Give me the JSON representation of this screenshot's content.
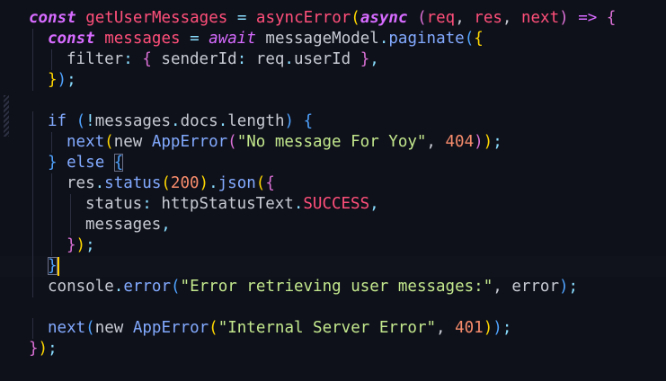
{
  "editor": {
    "language": "javascript",
    "theme_colors": {
      "background": "#0f111a",
      "keyword": "#d66bff",
      "function": "#ff4f7a",
      "identifier": "#c7c9d3",
      "string": "#c3e88d",
      "number": "#f78c6c",
      "punctuation": "#89ddff",
      "bracket_yellow": "#ffd700",
      "bracket_magenta": "#da70d6",
      "bracket_blue": "#4fa3ff",
      "cursor": "#ffcc00"
    },
    "lines": [
      {
        "indent": 0,
        "tokens": [
          {
            "t": "const",
            "c": "#d66bff",
            "italic": true,
            "bold": true
          },
          {
            "t": " ",
            "c": "#c7c9d3"
          },
          {
            "t": "getUserMessages",
            "c": "#ff4f7a"
          },
          {
            "t": " ",
            "c": "#c7c9d3"
          },
          {
            "t": "=",
            "c": "#89ddff"
          },
          {
            "t": " ",
            "c": "#c7c9d3"
          },
          {
            "t": "asyncError",
            "c": "#ff4f7a"
          },
          {
            "t": "(",
            "c": "#ffd700"
          },
          {
            "t": "async",
            "c": "#d66bff",
            "italic": true,
            "bold": true
          },
          {
            "t": " ",
            "c": "#c7c9d3"
          },
          {
            "t": "(",
            "c": "#da70d6"
          },
          {
            "t": "req",
            "c": "#ff4f7a"
          },
          {
            "t": ", ",
            "c": "#c7c9d3"
          },
          {
            "t": "res",
            "c": "#ff4f7a"
          },
          {
            "t": ", ",
            "c": "#c7c9d3"
          },
          {
            "t": "next",
            "c": "#ff4f7a"
          },
          {
            "t": ")",
            "c": "#da70d6"
          },
          {
            "t": " ",
            "c": "#c7c9d3"
          },
          {
            "t": "=>",
            "c": "#d66bff"
          },
          {
            "t": " ",
            "c": "#c7c9d3"
          },
          {
            "t": "{",
            "c": "#da70d6"
          }
        ]
      },
      {
        "indent": 1,
        "tokens": [
          {
            "t": "const",
            "c": "#d66bff",
            "italic": true,
            "bold": true
          },
          {
            "t": " ",
            "c": "#c7c9d3"
          },
          {
            "t": "messages",
            "c": "#ff4f7a"
          },
          {
            "t": " ",
            "c": "#c7c9d3"
          },
          {
            "t": "=",
            "c": "#89ddff"
          },
          {
            "t": " ",
            "c": "#c7c9d3"
          },
          {
            "t": "await",
            "c": "#d66bff",
            "italic": true
          },
          {
            "t": " ",
            "c": "#c7c9d3"
          },
          {
            "t": "messageModel",
            "c": "#c7c9d3"
          },
          {
            "t": ".",
            "c": "#89ddff"
          },
          {
            "t": "paginate",
            "c": "#82aaff"
          },
          {
            "t": "(",
            "c": "#4fa3ff"
          },
          {
            "t": "{",
            "c": "#ffd700"
          }
        ]
      },
      {
        "indent": 2,
        "tokens": [
          {
            "t": "filter",
            "c": "#c7c9d3"
          },
          {
            "t": ":",
            "c": "#89ddff"
          },
          {
            "t": " ",
            "c": "#c7c9d3"
          },
          {
            "t": "{",
            "c": "#da70d6"
          },
          {
            "t": " ",
            "c": "#c7c9d3"
          },
          {
            "t": "senderId",
            "c": "#c7c9d3"
          },
          {
            "t": ":",
            "c": "#89ddff"
          },
          {
            "t": " ",
            "c": "#c7c9d3"
          },
          {
            "t": "req",
            "c": "#c7c9d3"
          },
          {
            "t": ".",
            "c": "#89ddff"
          },
          {
            "t": "userId",
            "c": "#c7c9d3"
          },
          {
            "t": " ",
            "c": "#c7c9d3"
          },
          {
            "t": "}",
            "c": "#da70d6"
          },
          {
            "t": ",",
            "c": "#89ddff"
          }
        ]
      },
      {
        "indent": 1,
        "tokens": [
          {
            "t": "}",
            "c": "#ffd700"
          },
          {
            "t": ")",
            "c": "#4fa3ff"
          },
          {
            "t": ";",
            "c": "#89ddff"
          }
        ]
      },
      {
        "indent": 0,
        "tokens": []
      },
      {
        "indent": 1,
        "tokens": [
          {
            "t": "if",
            "c": "#82aaff"
          },
          {
            "t": " ",
            "c": "#c7c9d3"
          },
          {
            "t": "(",
            "c": "#4fa3ff"
          },
          {
            "t": "!",
            "c": "#89ddff"
          },
          {
            "t": "messages",
            "c": "#c7c9d3"
          },
          {
            "t": ".",
            "c": "#89ddff"
          },
          {
            "t": "docs",
            "c": "#c7c9d3"
          },
          {
            "t": ".",
            "c": "#89ddff"
          },
          {
            "t": "length",
            "c": "#c7c9d3"
          },
          {
            "t": ")",
            "c": "#4fa3ff"
          },
          {
            "t": " ",
            "c": "#c7c9d3"
          },
          {
            "t": "{",
            "c": "#4fa3ff"
          }
        ]
      },
      {
        "indent": 2,
        "tokens": [
          {
            "t": "next",
            "c": "#82aaff"
          },
          {
            "t": "(",
            "c": "#ffd700"
          },
          {
            "t": "new",
            "c": "#c7c9d3"
          },
          {
            "t": " ",
            "c": "#c7c9d3"
          },
          {
            "t": "AppError",
            "c": "#82aaff"
          },
          {
            "t": "(",
            "c": "#da70d6"
          },
          {
            "t": "\"No message For Yoy\"",
            "c": "#c3e88d"
          },
          {
            "t": ", ",
            "c": "#c7c9d3"
          },
          {
            "t": "404",
            "c": "#f78c6c"
          },
          {
            "t": ")",
            "c": "#da70d6"
          },
          {
            "t": ")",
            "c": "#ffd700"
          },
          {
            "t": ";",
            "c": "#89ddff"
          }
        ]
      },
      {
        "indent": 1,
        "tokens": [
          {
            "t": "}",
            "c": "#4fa3ff"
          },
          {
            "t": " ",
            "c": "#c7c9d3"
          },
          {
            "t": "else",
            "c": "#82aaff"
          },
          {
            "t": " ",
            "c": "#c7c9d3"
          },
          {
            "t": "{",
            "c": "#4fa3ff",
            "box": true
          }
        ]
      },
      {
        "indent": 2,
        "tokens": [
          {
            "t": "res",
            "c": "#c7c9d3"
          },
          {
            "t": ".",
            "c": "#89ddff"
          },
          {
            "t": "status",
            "c": "#82aaff"
          },
          {
            "t": "(",
            "c": "#ffd700"
          },
          {
            "t": "200",
            "c": "#f78c6c"
          },
          {
            "t": ")",
            "c": "#ffd700"
          },
          {
            "t": ".",
            "c": "#89ddff"
          },
          {
            "t": "json",
            "c": "#82aaff"
          },
          {
            "t": "(",
            "c": "#ffd700"
          },
          {
            "t": "{",
            "c": "#da70d6"
          }
        ]
      },
      {
        "indent": 3,
        "tokens": [
          {
            "t": "status",
            "c": "#c7c9d3"
          },
          {
            "t": ":",
            "c": "#89ddff"
          },
          {
            "t": " ",
            "c": "#c7c9d3"
          },
          {
            "t": "httpStatusText",
            "c": "#c7c9d3"
          },
          {
            "t": ".",
            "c": "#89ddff"
          },
          {
            "t": "SUCCESS",
            "c": "#ff4f7a"
          },
          {
            "t": ",",
            "c": "#89ddff"
          }
        ]
      },
      {
        "indent": 3,
        "tokens": [
          {
            "t": "messages",
            "c": "#c7c9d3"
          },
          {
            "t": ",",
            "c": "#89ddff"
          }
        ]
      },
      {
        "indent": 2,
        "tokens": [
          {
            "t": "}",
            "c": "#da70d6"
          },
          {
            "t": ")",
            "c": "#ffd700"
          },
          {
            "t": ";",
            "c": "#89ddff"
          }
        ]
      },
      {
        "indent": 1,
        "active": true,
        "tokens": [
          {
            "t": "}",
            "c": "#4fa3ff",
            "box": true
          }
        ]
      },
      {
        "indent": 1,
        "tokens": [
          {
            "t": "console",
            "c": "#c7c9d3"
          },
          {
            "t": ".",
            "c": "#89ddff"
          },
          {
            "t": "error",
            "c": "#82aaff"
          },
          {
            "t": "(",
            "c": "#4fa3ff"
          },
          {
            "t": "\"Error retrieving user messages:\"",
            "c": "#c3e88d"
          },
          {
            "t": ", ",
            "c": "#c7c9d3"
          },
          {
            "t": "error",
            "c": "#c7c9d3"
          },
          {
            "t": ")",
            "c": "#4fa3ff"
          },
          {
            "t": ";",
            "c": "#89ddff"
          }
        ]
      },
      {
        "indent": 0,
        "tokens": []
      },
      {
        "indent": 1,
        "tokens": [
          {
            "t": "next",
            "c": "#82aaff"
          },
          {
            "t": "(",
            "c": "#4fa3ff"
          },
          {
            "t": "new",
            "c": "#c7c9d3"
          },
          {
            "t": " ",
            "c": "#c7c9d3"
          },
          {
            "t": "AppError",
            "c": "#82aaff"
          },
          {
            "t": "(",
            "c": "#ffd700"
          },
          {
            "t": "\"Internal Server Error\"",
            "c": "#c3e88d"
          },
          {
            "t": ", ",
            "c": "#c7c9d3"
          },
          {
            "t": "401",
            "c": "#f78c6c"
          },
          {
            "t": ")",
            "c": "#ffd700"
          },
          {
            "t": ")",
            "c": "#4fa3ff"
          },
          {
            "t": ";",
            "c": "#89ddff"
          }
        ]
      },
      {
        "indent": 0,
        "tokens": [
          {
            "t": "}",
            "c": "#da70d6"
          },
          {
            "t": ")",
            "c": "#ffd700"
          },
          {
            "t": ";",
            "c": "#89ddff"
          }
        ]
      }
    ]
  }
}
